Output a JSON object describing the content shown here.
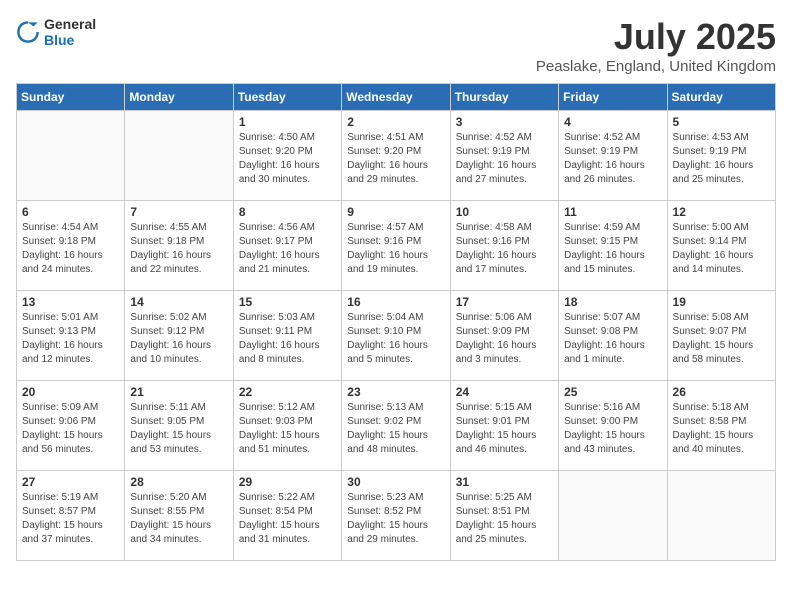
{
  "header": {
    "logo_general": "General",
    "logo_blue": "Blue",
    "month_title": "July 2025",
    "location": "Peaslake, England, United Kingdom"
  },
  "weekdays": [
    "Sunday",
    "Monday",
    "Tuesday",
    "Wednesday",
    "Thursday",
    "Friday",
    "Saturday"
  ],
  "weeks": [
    [
      {
        "day": "",
        "info": ""
      },
      {
        "day": "",
        "info": ""
      },
      {
        "day": "1",
        "info": "Sunrise: 4:50 AM\nSunset: 9:20 PM\nDaylight: 16 hours\nand 30 minutes."
      },
      {
        "day": "2",
        "info": "Sunrise: 4:51 AM\nSunset: 9:20 PM\nDaylight: 16 hours\nand 29 minutes."
      },
      {
        "day": "3",
        "info": "Sunrise: 4:52 AM\nSunset: 9:19 PM\nDaylight: 16 hours\nand 27 minutes."
      },
      {
        "day": "4",
        "info": "Sunrise: 4:52 AM\nSunset: 9:19 PM\nDaylight: 16 hours\nand 26 minutes."
      },
      {
        "day": "5",
        "info": "Sunrise: 4:53 AM\nSunset: 9:19 PM\nDaylight: 16 hours\nand 25 minutes."
      }
    ],
    [
      {
        "day": "6",
        "info": "Sunrise: 4:54 AM\nSunset: 9:18 PM\nDaylight: 16 hours\nand 24 minutes."
      },
      {
        "day": "7",
        "info": "Sunrise: 4:55 AM\nSunset: 9:18 PM\nDaylight: 16 hours\nand 22 minutes."
      },
      {
        "day": "8",
        "info": "Sunrise: 4:56 AM\nSunset: 9:17 PM\nDaylight: 16 hours\nand 21 minutes."
      },
      {
        "day": "9",
        "info": "Sunrise: 4:57 AM\nSunset: 9:16 PM\nDaylight: 16 hours\nand 19 minutes."
      },
      {
        "day": "10",
        "info": "Sunrise: 4:58 AM\nSunset: 9:16 PM\nDaylight: 16 hours\nand 17 minutes."
      },
      {
        "day": "11",
        "info": "Sunrise: 4:59 AM\nSunset: 9:15 PM\nDaylight: 16 hours\nand 15 minutes."
      },
      {
        "day": "12",
        "info": "Sunrise: 5:00 AM\nSunset: 9:14 PM\nDaylight: 16 hours\nand 14 minutes."
      }
    ],
    [
      {
        "day": "13",
        "info": "Sunrise: 5:01 AM\nSunset: 9:13 PM\nDaylight: 16 hours\nand 12 minutes."
      },
      {
        "day": "14",
        "info": "Sunrise: 5:02 AM\nSunset: 9:12 PM\nDaylight: 16 hours\nand 10 minutes."
      },
      {
        "day": "15",
        "info": "Sunrise: 5:03 AM\nSunset: 9:11 PM\nDaylight: 16 hours\nand 8 minutes."
      },
      {
        "day": "16",
        "info": "Sunrise: 5:04 AM\nSunset: 9:10 PM\nDaylight: 16 hours\nand 5 minutes."
      },
      {
        "day": "17",
        "info": "Sunrise: 5:06 AM\nSunset: 9:09 PM\nDaylight: 16 hours\nand 3 minutes."
      },
      {
        "day": "18",
        "info": "Sunrise: 5:07 AM\nSunset: 9:08 PM\nDaylight: 16 hours\nand 1 minute."
      },
      {
        "day": "19",
        "info": "Sunrise: 5:08 AM\nSunset: 9:07 PM\nDaylight: 15 hours\nand 58 minutes."
      }
    ],
    [
      {
        "day": "20",
        "info": "Sunrise: 5:09 AM\nSunset: 9:06 PM\nDaylight: 15 hours\nand 56 minutes."
      },
      {
        "day": "21",
        "info": "Sunrise: 5:11 AM\nSunset: 9:05 PM\nDaylight: 15 hours\nand 53 minutes."
      },
      {
        "day": "22",
        "info": "Sunrise: 5:12 AM\nSunset: 9:03 PM\nDaylight: 15 hours\nand 51 minutes."
      },
      {
        "day": "23",
        "info": "Sunrise: 5:13 AM\nSunset: 9:02 PM\nDaylight: 15 hours\nand 48 minutes."
      },
      {
        "day": "24",
        "info": "Sunrise: 5:15 AM\nSunset: 9:01 PM\nDaylight: 15 hours\nand 46 minutes."
      },
      {
        "day": "25",
        "info": "Sunrise: 5:16 AM\nSunset: 9:00 PM\nDaylight: 15 hours\nand 43 minutes."
      },
      {
        "day": "26",
        "info": "Sunrise: 5:18 AM\nSunset: 8:58 PM\nDaylight: 15 hours\nand 40 minutes."
      }
    ],
    [
      {
        "day": "27",
        "info": "Sunrise: 5:19 AM\nSunset: 8:57 PM\nDaylight: 15 hours\nand 37 minutes."
      },
      {
        "day": "28",
        "info": "Sunrise: 5:20 AM\nSunset: 8:55 PM\nDaylight: 15 hours\nand 34 minutes."
      },
      {
        "day": "29",
        "info": "Sunrise: 5:22 AM\nSunset: 8:54 PM\nDaylight: 15 hours\nand 31 minutes."
      },
      {
        "day": "30",
        "info": "Sunrise: 5:23 AM\nSunset: 8:52 PM\nDaylight: 15 hours\nand 29 minutes."
      },
      {
        "day": "31",
        "info": "Sunrise: 5:25 AM\nSunset: 8:51 PM\nDaylight: 15 hours\nand 25 minutes."
      },
      {
        "day": "",
        "info": ""
      },
      {
        "day": "",
        "info": ""
      }
    ]
  ]
}
